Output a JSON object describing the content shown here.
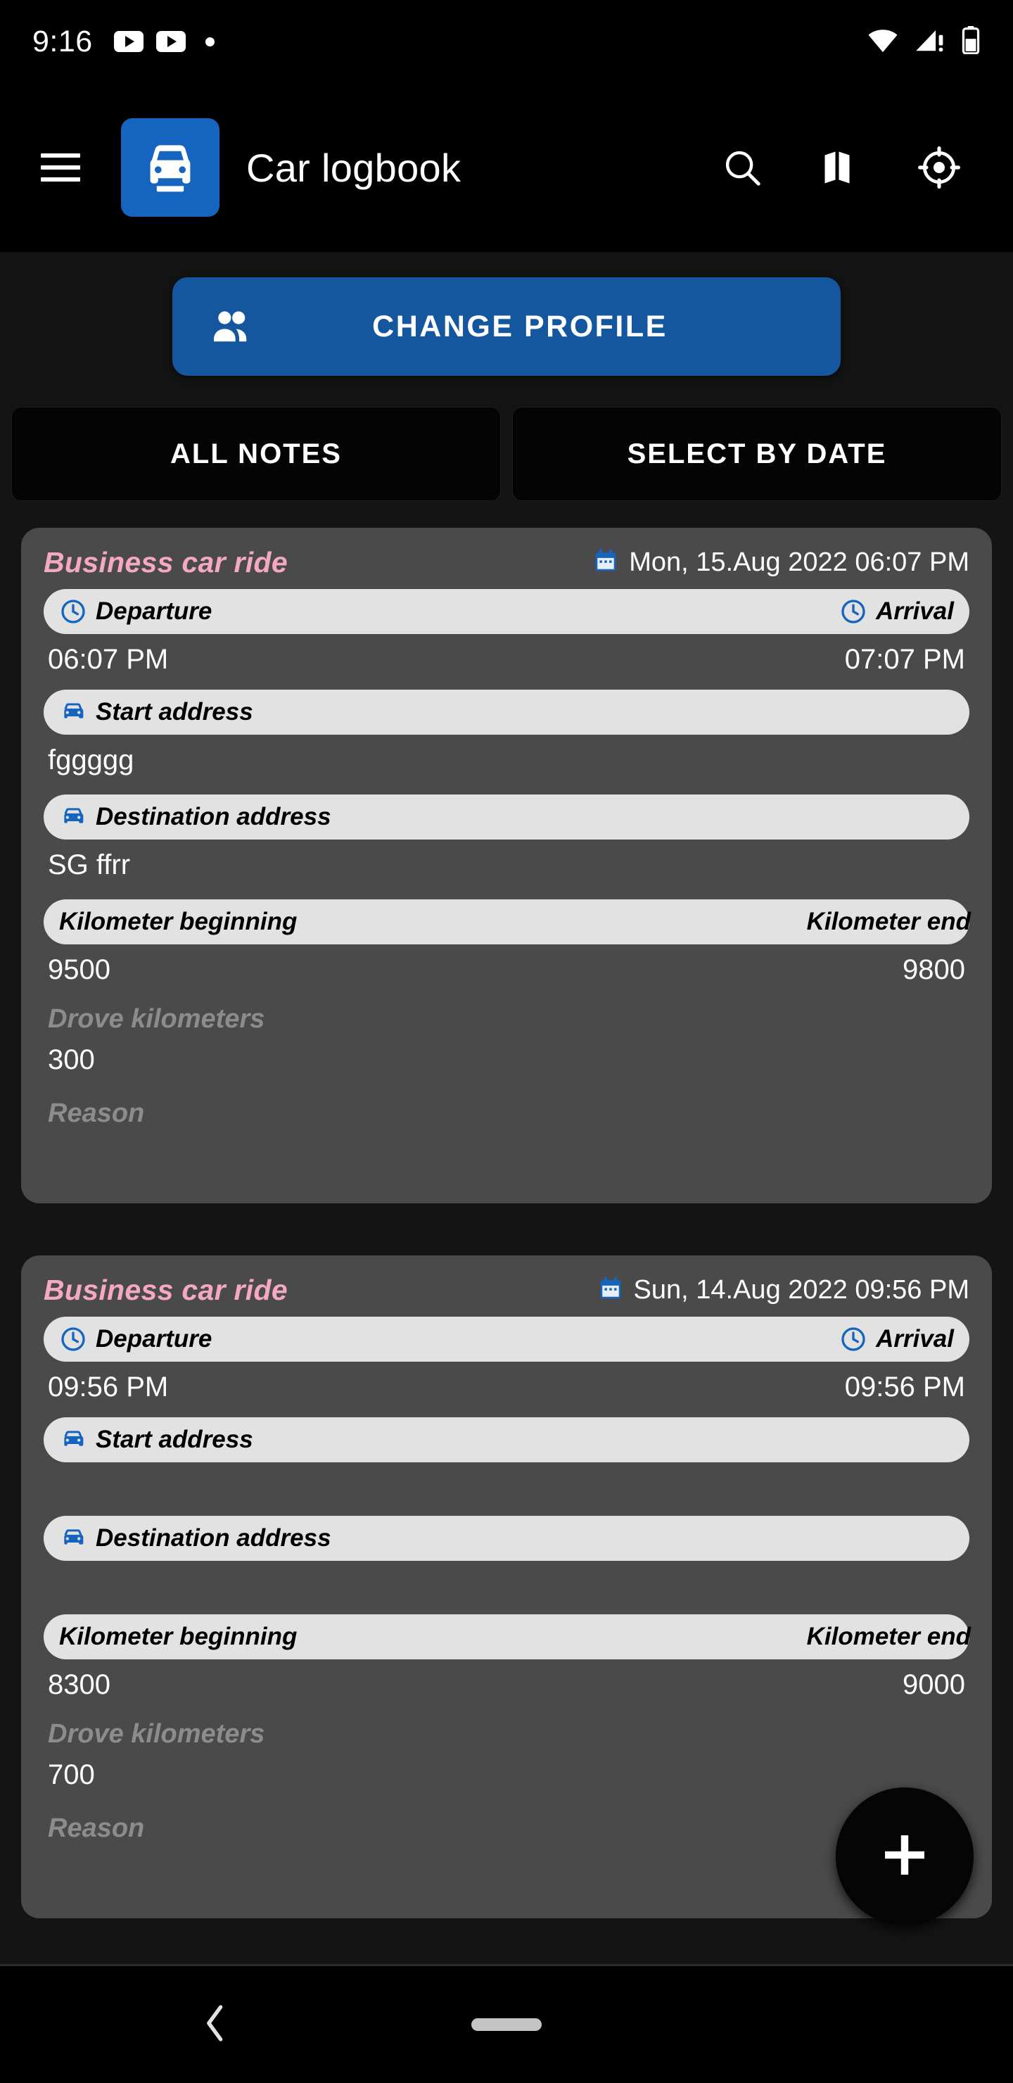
{
  "status_bar": {
    "time": "9:16",
    "left_icons": [
      "youtube-play-badge",
      "youtube-play-badge",
      "notification-dot"
    ],
    "right_icons": [
      "wifi-icon",
      "cellular-signal-warning-icon",
      "battery-icon"
    ]
  },
  "app_bar": {
    "menu_icon": "hamburger-menu-icon",
    "logo_icon": "car-logbook-logo-icon",
    "title": "Car logbook",
    "actions": [
      {
        "name": "search-icon",
        "label": "Search"
      },
      {
        "name": "map-icon",
        "label": "Map"
      },
      {
        "name": "my-location-icon",
        "label": "My location"
      }
    ]
  },
  "profile": {
    "button_label": "CHANGE PROFILE",
    "icon": "people-icon",
    "color": "#14579E"
  },
  "tabs": [
    {
      "label": "ALL NOTES",
      "selected": true
    },
    {
      "label": "SELECT BY DATE",
      "selected": false
    }
  ],
  "labels": {
    "departure": "Departure",
    "arrival": "Arrival",
    "start_address": "Start address",
    "destination_address": "Destination address",
    "kilometer_beginning": "Kilometer beginning",
    "kilometer_end": "Kilometer end",
    "drove_kilometers": "Drove kilometers",
    "reason": "Reason"
  },
  "colors": {
    "accent_blue": "#1565C0",
    "title_pink": "#F4A9C0",
    "card_bg": "#4a4a4a",
    "pill_bg": "#E2E2E2",
    "page_bg": "#141414",
    "muted_label": "#8C8C8C"
  },
  "notes": [
    {
      "title": "Business car ride",
      "date": "Mon, 15.Aug 2022 06:07 PM",
      "departure_time": "06:07 PM",
      "arrival_time": "07:07 PM",
      "start_address": "fggggg",
      "destination_address": "SG ffrr",
      "kilometer_beginning": "9500",
      "kilometer_end": "9800",
      "drove_kilometers": "300",
      "reason": ""
    },
    {
      "title": "Business car ride",
      "date": "Sun, 14.Aug 2022 09:56 PM",
      "departure_time": "09:56 PM",
      "arrival_time": "09:56 PM",
      "start_address": "",
      "destination_address": "",
      "kilometer_beginning": "8300",
      "kilometer_end": "9000",
      "drove_kilometers": "700",
      "reason": ""
    }
  ],
  "fab": {
    "icon": "plus-icon",
    "label": "Add note"
  },
  "nav_bar": {
    "back_icon": "back-chevron-icon",
    "home_pill": "home-gesture-pill"
  }
}
